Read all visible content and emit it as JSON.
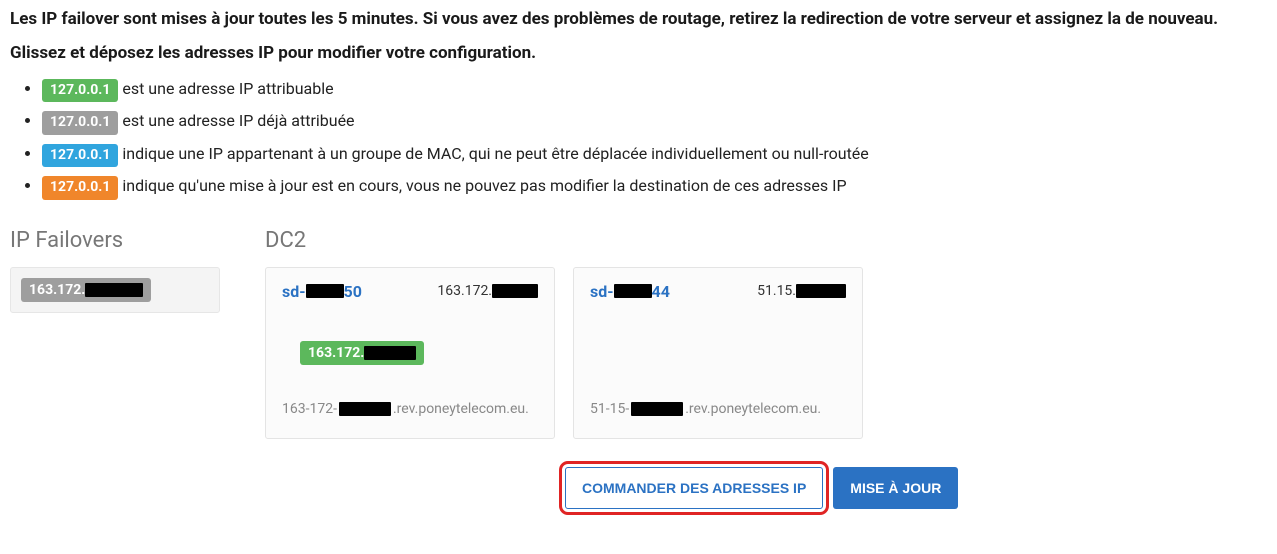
{
  "intro": {
    "line1": "Les IP failover sont mises à jour toutes les 5 minutes. Si vous avez des problèmes de routage, retirez la redirection de votre serveur et assignez la de nouveau.",
    "line2": "Glissez et déposez les adresses IP pour modifier votre configuration."
  },
  "legend": {
    "ip_example": "127.0.0.1",
    "assignable": " est une adresse IP attribuable",
    "assigned": " est une adresse IP déjà attribuée",
    "mac_group": " indique une IP appartenant à un groupe de MAC, qui ne peut être déplacée individuellement ou null-routée",
    "updating": " indique qu'une mise à jour est en cours, vous ne pouvez pas modifier la destination de ces adresses IP"
  },
  "sections": {
    "failovers_title": "IP Failovers",
    "dc_title": "DC2"
  },
  "failover_chip": {
    "prefix": "163.172."
  },
  "servers": [
    {
      "name_prefix": "sd-",
      "name_suffix": "50",
      "ip_prefix": "163.172.",
      "assigned_ip_prefix": "163.172.",
      "rev_prefix": "163-172-",
      "rev_suffix": ".rev.poneytelecom.eu."
    },
    {
      "name_prefix": "sd-",
      "name_suffix": "44",
      "ip_prefix": "51.15.",
      "assigned_ip_prefix": "",
      "rev_prefix": "51-15-",
      "rev_suffix": ".rev.poneytelecom.eu."
    }
  ],
  "actions": {
    "order": "COMMANDER DES ADRESSES IP",
    "update": "MISE À JOUR"
  }
}
